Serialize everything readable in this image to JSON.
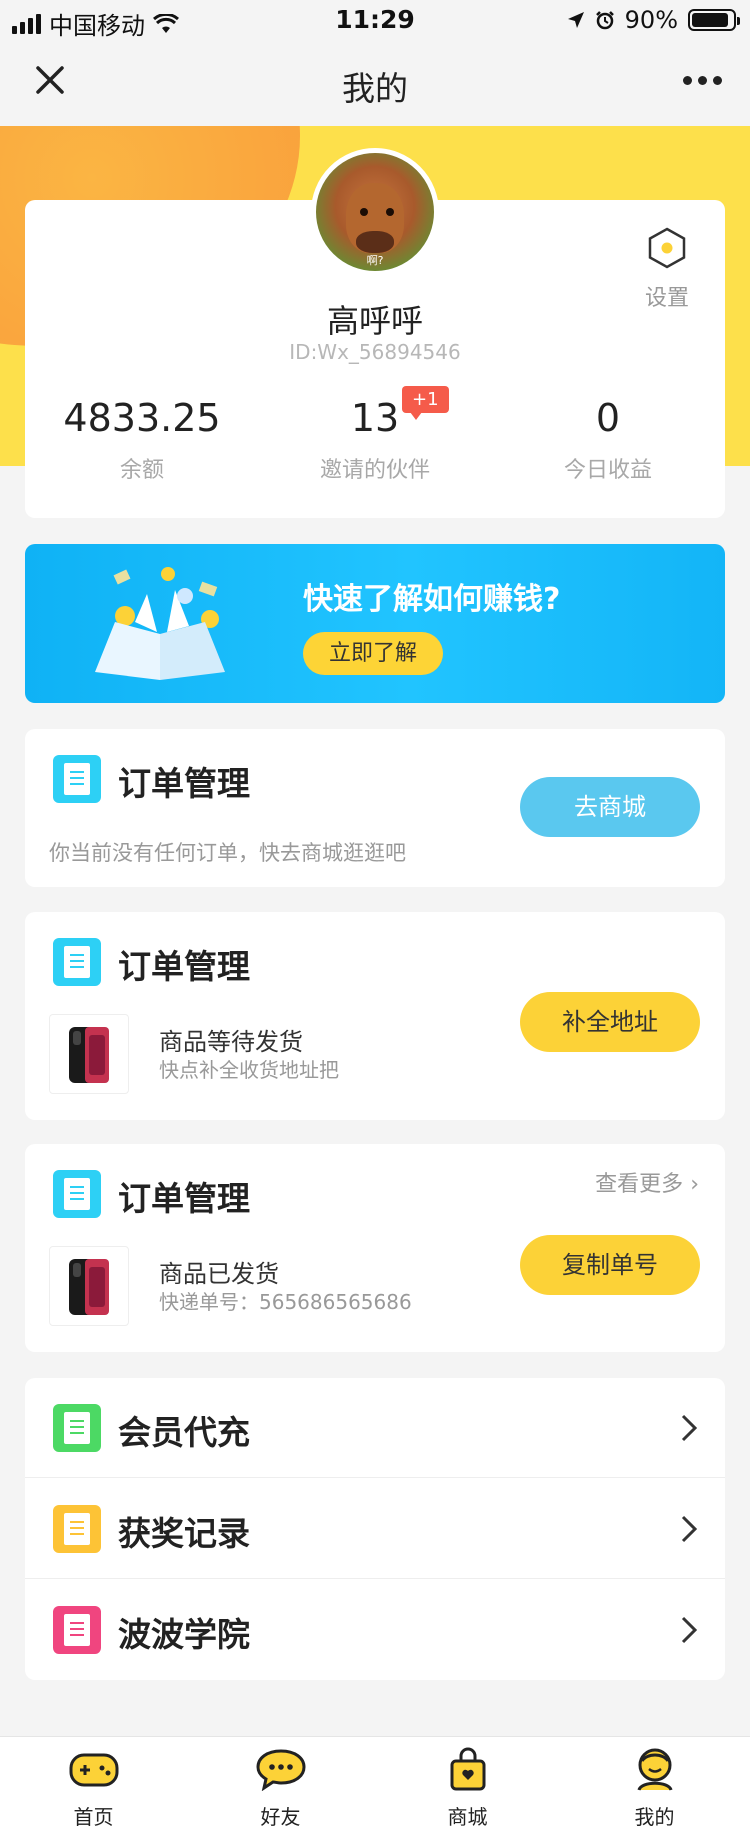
{
  "status_bar": {
    "carrier": "中国移动",
    "time": "11:29",
    "battery": "90%",
    "battery_level": 0.9
  },
  "nav": {
    "title": "我的"
  },
  "profile": {
    "avatar_caption": "啊?",
    "settings_label": "设置",
    "name": "高呼呼",
    "id_text": "ID:Wx_56894546",
    "stats": [
      {
        "value": "4833.25",
        "label": "余额"
      },
      {
        "value": "13",
        "label": "邀请的伙伴"
      },
      {
        "value": "0",
        "label": "今日收益"
      }
    ],
    "invite_badge": "+1"
  },
  "banner": {
    "title": "快速了解如何赚钱?",
    "button": "立即了解"
  },
  "orders": [
    {
      "title": "订单管理",
      "desc": "你当前没有任何订单，快去商城逛逛吧",
      "button": "去商城"
    },
    {
      "title": "订单管理",
      "goods_title": "商品等待发货",
      "goods_sub": "快点补全收货地址把",
      "button": "补全地址"
    },
    {
      "title": "订单管理",
      "more": "查看更多",
      "goods_title": "商品已发货",
      "goods_sub": "快递单号：565686565686",
      "button": "复制单号"
    }
  ],
  "menu": [
    {
      "label": "会员代充",
      "color": "#4cd964"
    },
    {
      "label": "获奖记录",
      "color": "#fdc336"
    },
    {
      "label": "波波学院",
      "color": "#f0457f"
    }
  ],
  "tabs": [
    {
      "label": "首页"
    },
    {
      "label": "好友"
    },
    {
      "label": "商城"
    },
    {
      "label": "我的"
    }
  ],
  "colors": {
    "accent_yellow": "#fcd237",
    "accent_blue": "#21c4ff",
    "doc_icon_cyan": "#2dd0f5",
    "badge_red": "#f55b4a"
  }
}
